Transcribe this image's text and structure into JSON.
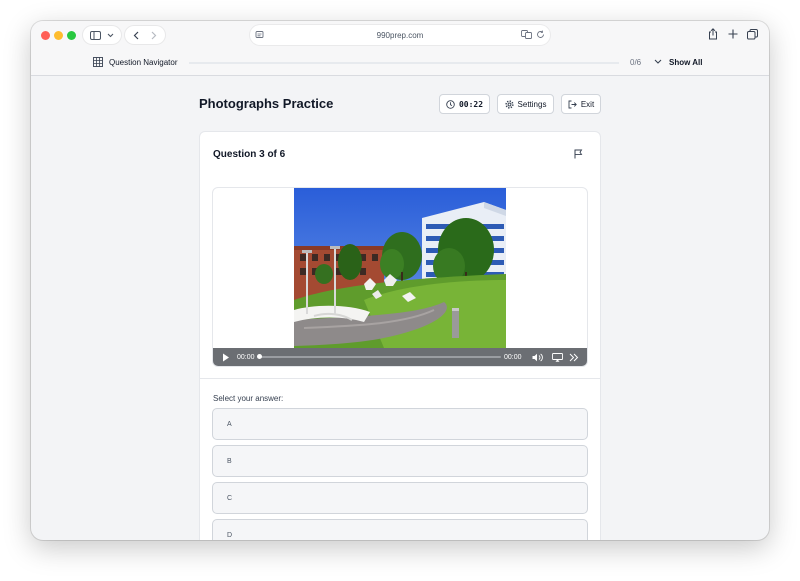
{
  "browser": {
    "url": "990prep.com"
  },
  "navigator": {
    "label": "Question Navigator",
    "count": "0/6",
    "show_all": "Show All"
  },
  "page": {
    "title": "Photographs Practice",
    "timer": "00:22",
    "settings_label": "Settings",
    "exit_label": "Exit"
  },
  "question": {
    "title": "Question 3 of 6",
    "player": {
      "current_time": "00:00",
      "duration": "00:00",
      "progress": 0
    },
    "select_label": "Select your answer:",
    "options": [
      "A",
      "B",
      "C",
      "D"
    ]
  },
  "colors": {
    "accent": "#111827",
    "window_bg": "#f3f4f6",
    "card_bg": "#ffffff"
  }
}
